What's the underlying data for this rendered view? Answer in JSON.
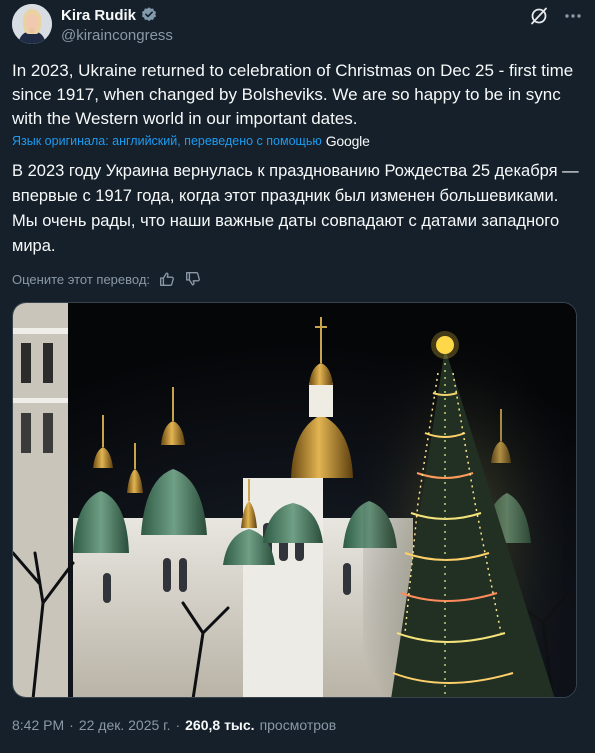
{
  "author": {
    "display_name": "Kira Rudik",
    "handle": "@kiraincongress"
  },
  "post": {
    "text": "In 2023, Ukraine returned to celebration of Christmas on Dec 25 - first time since 1917, when changed by Bolsheviks. We are so happy to be in sync with the Western world in our important dates."
  },
  "translation": {
    "source_note": "Язык оригинала: английский, переведено с помощью",
    "provider": "Google",
    "text": "В 2023 году Украина вернулась к празднованию Рождества 25 декабря — впервые с 1917 года, когда этот праздник был изменен большевиками. Мы очень рады, что наши важные даты совпадают с датами западного мира.",
    "rate_prompt": "Оцените этот перевод:"
  },
  "meta": {
    "time": "8:42 PM",
    "separator": "·",
    "date": "22 дек. 2025 г.",
    "views_count": "260,8 тыс.",
    "views_label": "просмотров"
  },
  "colors": {
    "background": "#15202b",
    "accent": "#1d9bf0",
    "muted": "#8b98a5"
  },
  "icons": [
    "verified-badge-icon",
    "grok-icon",
    "more-icon",
    "thumbs-up-icon",
    "thumbs-down-icon"
  ]
}
